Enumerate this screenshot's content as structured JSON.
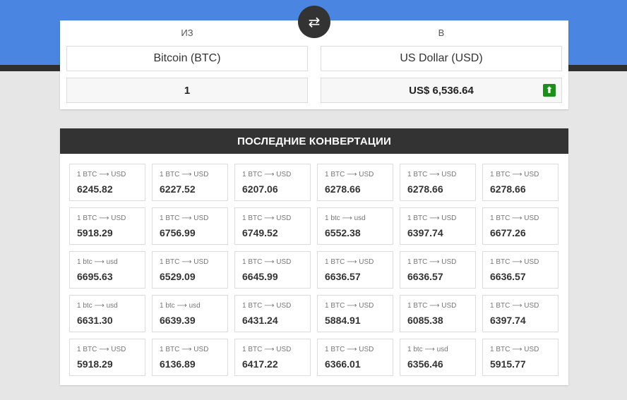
{
  "converter": {
    "from_label": "ИЗ",
    "to_label": "В",
    "from_currency": "Bitcoin (BTC)",
    "to_currency": "US Dollar (USD)",
    "amount": "1",
    "result": "US$ 6,536.64",
    "swap_icon": "⇄",
    "trend_icon": "⬆",
    "trend_color": "#1a8f1a"
  },
  "recent": {
    "title": "ПОСЛЕДНИЕ КОНВЕРТАЦИИ",
    "items": [
      {
        "pair": "1 BTC ⟶ USD",
        "value": "6245.82"
      },
      {
        "pair": "1 BTC ⟶ USD",
        "value": "6227.52"
      },
      {
        "pair": "1 BTC ⟶ USD",
        "value": "6207.06"
      },
      {
        "pair": "1 BTC ⟶ USD",
        "value": "6278.66"
      },
      {
        "pair": "1 BTC ⟶ USD",
        "value": "6278.66"
      },
      {
        "pair": "1 BTC ⟶ USD",
        "value": "6278.66"
      },
      {
        "pair": "1 BTC ⟶ USD",
        "value": "5918.29"
      },
      {
        "pair": "1 BTC ⟶ USD",
        "value": "6756.99"
      },
      {
        "pair": "1 BTC ⟶ USD",
        "value": "6749.52"
      },
      {
        "pair": "1 btc ⟶ usd",
        "value": "6552.38"
      },
      {
        "pair": "1 BTC ⟶ USD",
        "value": "6397.74"
      },
      {
        "pair": "1 BTC ⟶ USD",
        "value": "6677.26"
      },
      {
        "pair": "1 btc ⟶ usd",
        "value": "6695.63"
      },
      {
        "pair": "1 BTC ⟶ USD",
        "value": "6529.09"
      },
      {
        "pair": "1 BTC ⟶ USD",
        "value": "6645.99"
      },
      {
        "pair": "1 BTC ⟶ USD",
        "value": "6636.57"
      },
      {
        "pair": "1 BTC ⟶ USD",
        "value": "6636.57"
      },
      {
        "pair": "1 BTC ⟶ USD",
        "value": "6636.57"
      },
      {
        "pair": "1 btc ⟶ usd",
        "value": "6631.30"
      },
      {
        "pair": "1 btc ⟶ usd",
        "value": "6639.39"
      },
      {
        "pair": "1 BTC ⟶ USD",
        "value": "6431.24"
      },
      {
        "pair": "1 BTC ⟶ USD",
        "value": "5884.91"
      },
      {
        "pair": "1 BTC ⟶ USD",
        "value": "6085.38"
      },
      {
        "pair": "1 BTC ⟶ USD",
        "value": "6397.74"
      },
      {
        "pair": "1 BTC ⟶ USD",
        "value": "5918.29"
      },
      {
        "pair": "1 BTC ⟶ USD",
        "value": "6136.89"
      },
      {
        "pair": "1 BTC ⟶ USD",
        "value": "6417.22"
      },
      {
        "pair": "1 BTC ⟶ USD",
        "value": "6366.01"
      },
      {
        "pair": "1 btc ⟶ usd",
        "value": "6356.46"
      },
      {
        "pair": "1 BTC ⟶ USD",
        "value": "5915.77"
      }
    ]
  },
  "colors": {
    "header_blue": "#4a85e2",
    "dark": "#333333",
    "background": "#e6e6e6"
  }
}
